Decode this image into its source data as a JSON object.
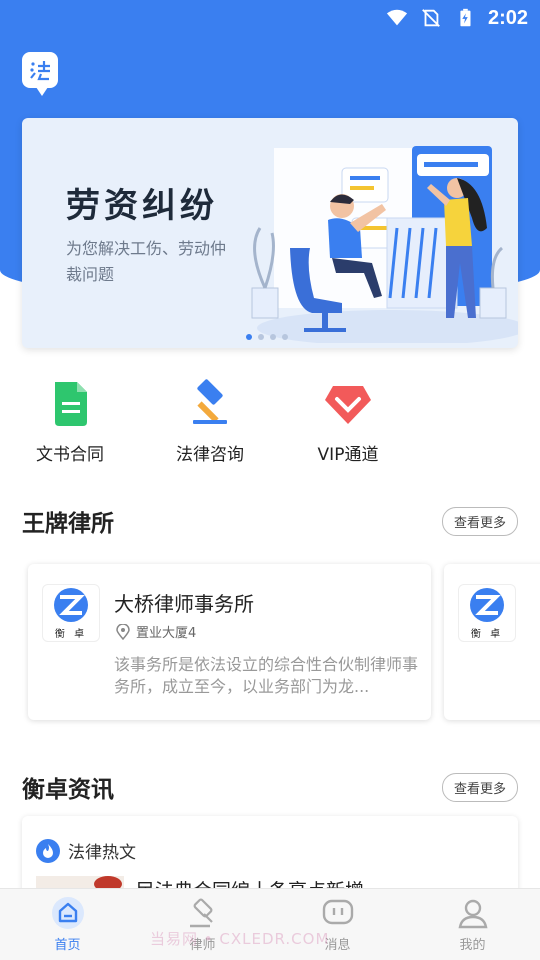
{
  "status_bar": {
    "time": "2:02"
  },
  "banner": {
    "title": "劳资纠纷",
    "subtitle": "为您解决工伤、劳动仲裁问题",
    "dots": 4,
    "active_dot": 0
  },
  "quick_actions": [
    {
      "label": "文书合同",
      "icon": "document-icon"
    },
    {
      "label": "法律咨询",
      "icon": "gavel-icon"
    },
    {
      "label": "VIP通道",
      "icon": "vip-heart-icon"
    }
  ],
  "law_firms": {
    "title": "王牌律所",
    "more_label": "查看更多",
    "items": [
      {
        "logo_text": "衡 卓",
        "name": "大桥律师事务所",
        "address": "置业大厦4",
        "description": "该事务所是依法设立的综合性合伙制律师事务所，成立至今，以业务部门为龙..."
      },
      {
        "logo_text": "衡 卓"
      }
    ]
  },
  "news": {
    "title": "衡卓资讯",
    "more_label": "查看更多",
    "tag": "法律热文",
    "headline": "民法典合同编十条亮点新增"
  },
  "tab_bar": [
    {
      "label": "首页",
      "active": true
    },
    {
      "label": "律师",
      "active": false
    },
    {
      "label": "消息",
      "active": false
    },
    {
      "label": "我的",
      "active": false
    }
  ],
  "watermark": "当易网 • CXLEDR.COM",
  "colors": {
    "primary": "#3a7ff0",
    "vip": "#f25a5a",
    "doc": "#2ec66e"
  }
}
